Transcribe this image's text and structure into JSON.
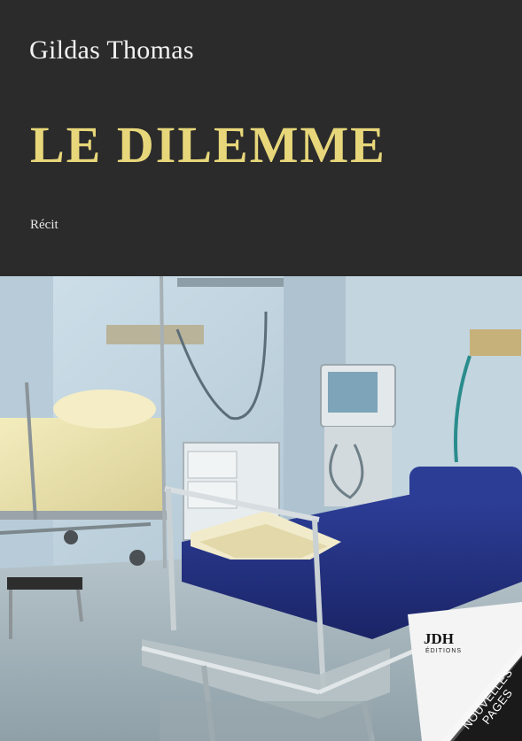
{
  "cover": {
    "author": "Gildas Thomas",
    "title": "LE DILEMME",
    "genre": "Récit"
  },
  "publisher": {
    "logo_text": "JDH",
    "logo_subtext": "ÉDITIONS",
    "collection_line1": "NOUVELLES",
    "collection_line2": "PAGES"
  },
  "colors": {
    "header_background": "#2b2b2b",
    "title_color": "#e7d77a",
    "author_color": "#f2f2f2"
  },
  "image": {
    "subject": "hospital-room-photo"
  }
}
